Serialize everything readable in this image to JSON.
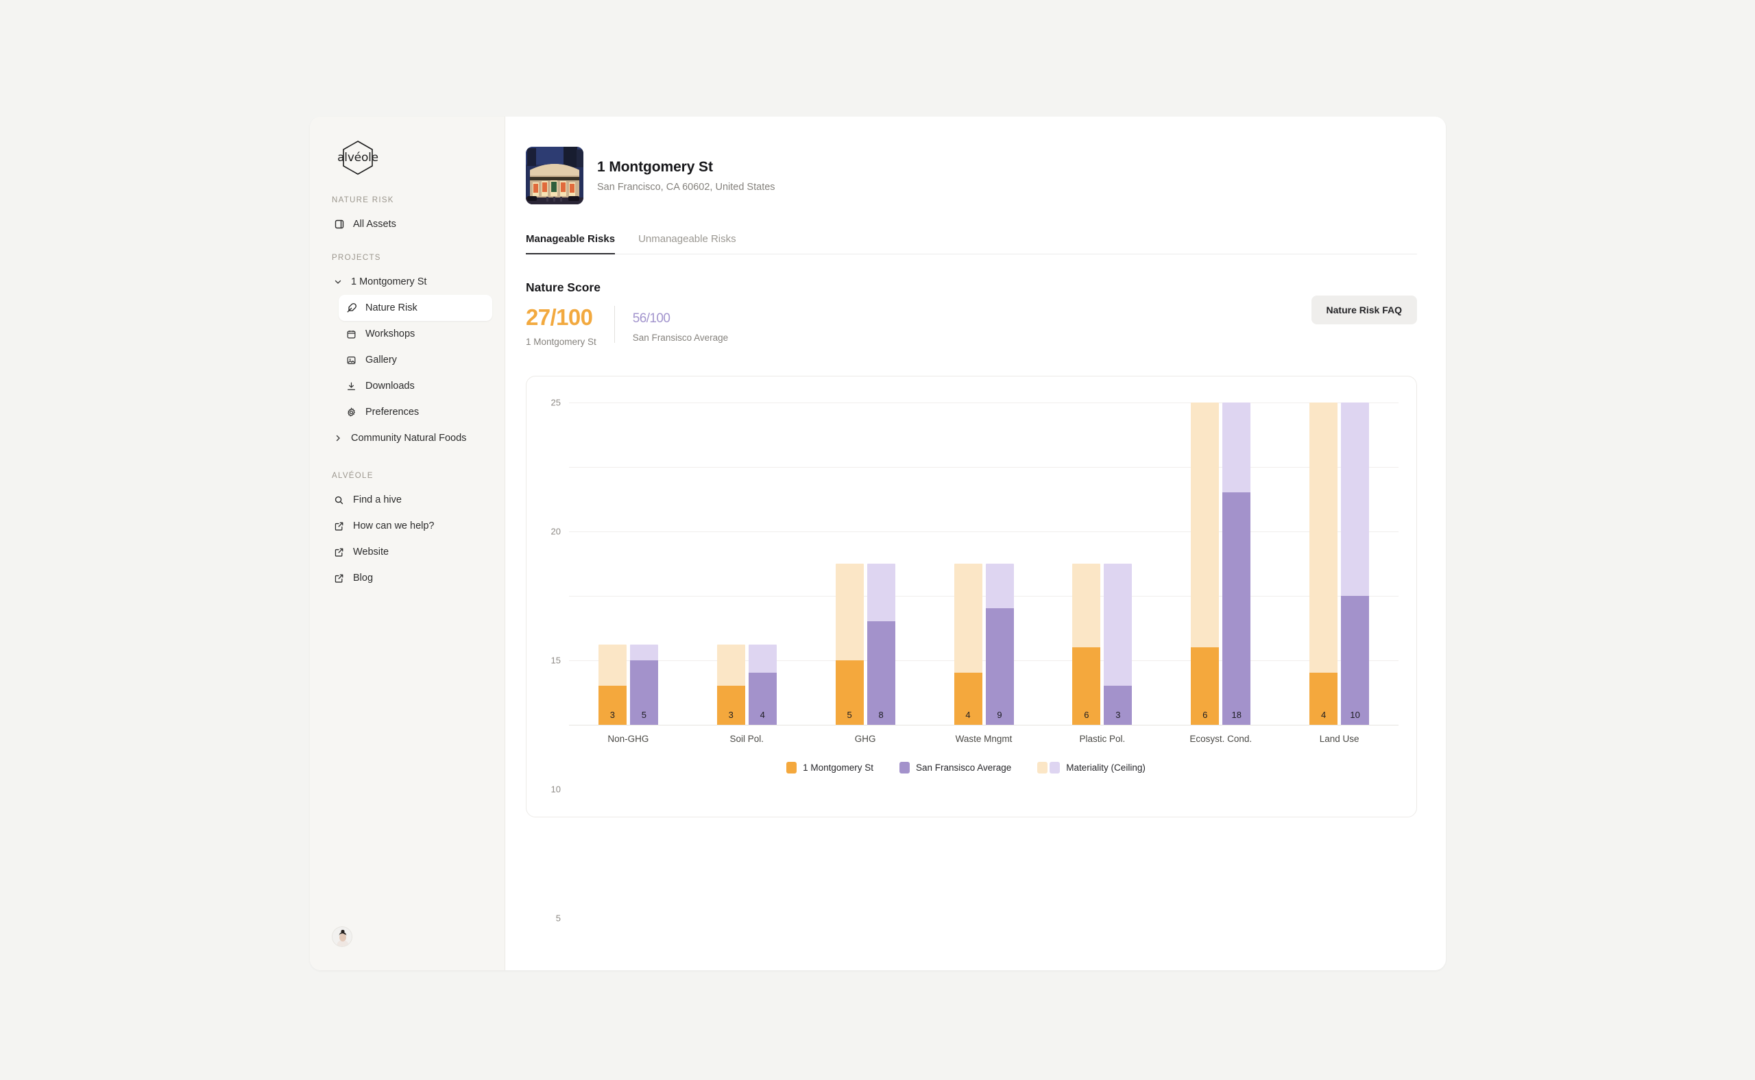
{
  "sidebar": {
    "logo_text": "alvéole",
    "sections": [
      {
        "label": "NATURE RISK"
      },
      {
        "label": "PROJECTS"
      },
      {
        "label": "ALVÉOLE"
      }
    ],
    "items": {
      "all_assets": "All Assets",
      "project_one": "1 Montgomery St",
      "nature_risk": "Nature Risk",
      "workshops": "Workshops",
      "gallery": "Gallery",
      "downloads": "Downloads",
      "preferences": "Preferences",
      "project_two": "Community Natural Foods",
      "find_a_hive": "Find a hive",
      "how_can_we_help": "How can we help?",
      "website": "Website",
      "blog": "Blog"
    }
  },
  "asset": {
    "title": "1 Montgomery St",
    "address": "San Francisco, CA 60602, United States"
  },
  "tabs": {
    "manageable": "Manageable Risks",
    "unmanageable": "Unmanageable Risks"
  },
  "score": {
    "heading": "Nature Score",
    "asset_value": "27/100",
    "asset_caption": "1 Montgomery St",
    "average_value": "56/100",
    "average_caption": "San Fransisco Average",
    "faq_button": "Nature Risk FAQ",
    "asset_color": "#f2a93f",
    "average_color": "#a294cd"
  },
  "chart_data": {
    "type": "bar",
    "title": "",
    "xlabel": "",
    "ylabel": "",
    "ylim": [
      0,
      25
    ],
    "yticks": [
      0,
      5,
      10,
      15,
      20,
      25
    ],
    "grid": true,
    "legend_position": "bottom",
    "categories": [
      "Non-GHG",
      "Soil Pol.",
      "GHG",
      "Waste Mngmt",
      "Plastic Pol.",
      "Ecosyst. Cond.",
      "Land Use"
    ],
    "series": [
      {
        "name": "1 Montgomery St",
        "color": "#f4a83d",
        "values": [
          3,
          3,
          5,
          4,
          6,
          6,
          4
        ]
      },
      {
        "name": "San Fransisco Average",
        "color": "#a392cb",
        "values": [
          5,
          4,
          8,
          9,
          3,
          18,
          10
        ]
      }
    ],
    "ceilings": {
      "name": "Materiality (Ceiling)",
      "color_asset": "#fbe6c6",
      "color_average": "#ded5f1",
      "values": [
        6.2,
        6.2,
        12.5,
        12.5,
        12.5,
        25,
        25
      ]
    },
    "legend": [
      {
        "label": "1 Montgomery St",
        "kind": "single",
        "color": "#f4a83d"
      },
      {
        "label": "San Fransisco Average",
        "kind": "single",
        "color": "#a392cb"
      },
      {
        "label": "Materiality (Ceiling)",
        "kind": "pair",
        "color": "#fbe6c6",
        "color2": "#ded5f1"
      }
    ]
  }
}
